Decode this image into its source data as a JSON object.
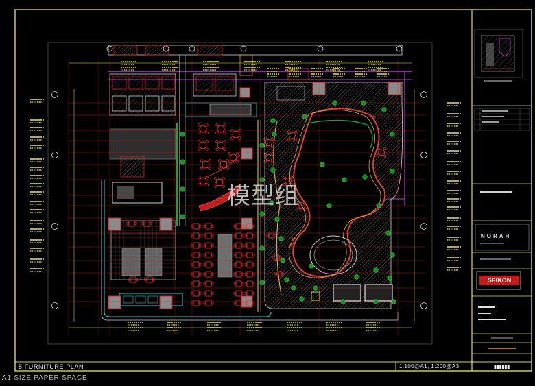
{
  "drawing": {
    "title": "5 FURNITURE PLAN",
    "scale": "1:100@A1, 1:200@A3",
    "space": "A1 SIZE PAPER SPACE",
    "watermark": "模型组"
  },
  "title_block": {
    "project": "NORAH",
    "logo": "SEIKON"
  },
  "colors": {
    "background": "#000000",
    "border": "#d9d94a",
    "wall": "#e02020",
    "stair": "#e02020",
    "furniture": "#ff3030",
    "glazing": "#b040d0",
    "tree": "#1aa52a",
    "dimension": "#f0f020",
    "cyan": "#20d8d8",
    "white": "#e0e0e0"
  }
}
